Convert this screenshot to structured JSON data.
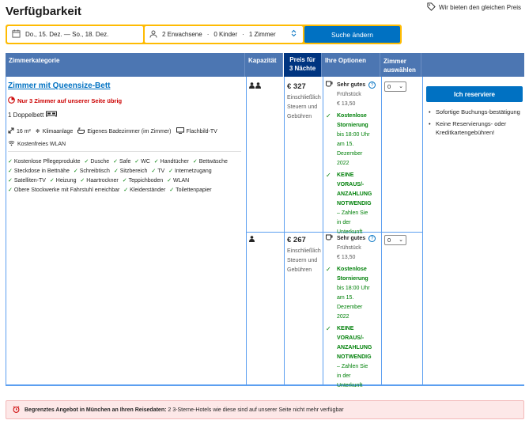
{
  "page": {
    "title": "Verfügbarkeit",
    "price_match": "Wir bieten den gleichen Preis"
  },
  "search": {
    "dates": "Do., 15. Dez. — So., 18. Dez.",
    "adults": "2 Erwachsene",
    "children": "0 Kinder",
    "rooms": "1 Zimmer",
    "submit_label": "Suche ändern"
  },
  "table": {
    "headers": {
      "room_type": "Zimmerkategorie",
      "capacity": "Kapazität",
      "price_line1": "Preis für",
      "price_line2": "3 Nächte",
      "options": "Ihre Optionen",
      "select_line1": "Zimmer",
      "select_line2": "auswählen"
    },
    "room": {
      "name": "Zimmer mit Queensize-Bett",
      "scarcity": "Nur 3 Zimmer auf unserer Seite übrig",
      "bed": "1 Doppelbett",
      "facilities": [
        "16 m²",
        "Klimaanlage",
        "Eigenes Badezimmer (im Zimmer)",
        "Flachbild-TV",
        "Kostenfreies WLAN"
      ],
      "amenities": [
        "Kostenlose Pflegeprodukte",
        "Dusche",
        "Safe",
        "WC",
        "Handtücher",
        "Bettwäsche",
        "Steckdose in Bettnähe",
        "Schreibtisch",
        "Sitzbereich",
        "TV",
        "Internetzugang",
        "Satelliten-TV",
        "Heizung",
        "Haartrockner",
        "Teppichboden",
        "WLAN",
        "Obere Stockwerke mit Fahrstuhl erreichbar",
        "Kleiderständer",
        "Toilettenpapier"
      ]
    },
    "offers": [
      {
        "price": "€ 327",
        "price_note": [
          "Einschließlich",
          "Steuern und",
          "Gebühren"
        ],
        "breakfast_title": "Sehr gutes",
        "breakfast_sub": "Frühstück",
        "breakfast_price": "€ 13,50",
        "cancel_bold": [
          "Kostenlose",
          "Stornierung"
        ],
        "cancel_lines": [
          "bis 18:00 Uhr",
          "am 15.",
          "Dezember",
          "2022"
        ],
        "prepay_bold": [
          "KEINE",
          "VORAUS/-",
          "ANZAHLUNG",
          "NOTWENDIG"
        ],
        "prepay_lines": [
          "– Zahlen Sie",
          "in der",
          "Unterkunft"
        ],
        "quantity": "0"
      },
      {
        "price": "€ 267",
        "price_note": [
          "Einschließlich",
          "Steuern und",
          "Gebühren"
        ],
        "breakfast_title": "Sehr gutes",
        "breakfast_sub": "Frühstück",
        "breakfast_price": "€ 13,50",
        "cancel_bold": [
          "Kostenlose",
          "Stornierung"
        ],
        "cancel_lines": [
          "bis 18:00 Uhr",
          "am 15.",
          "Dezember",
          "2022"
        ],
        "prepay_bold": [
          "KEINE",
          "VORAUS/-",
          "ANZAHLUNG",
          "NOTWENDIG"
        ],
        "prepay_lines": [
          "– Zahlen Sie",
          "in der",
          "Unterkunft"
        ],
        "quantity": "0"
      }
    ],
    "reserve_label": "Ich reserviere",
    "benefits": [
      "Sofortige Buchungs-bestätigung",
      "Keine Reservierungs- oder Kreditkartengebühren!"
    ]
  },
  "alert": {
    "bold": "Begrenztes Angebot in München an Ihren Reisedaten:",
    "text": "2 3-Sterne-Hotels wie diese sind auf unserer Seite nicht mehr verfügbar"
  },
  "colors": {
    "brand_blue": "#0071c2",
    "header_blue": "#4c76b2",
    "dark_blue": "#003580",
    "accent_yellow": "#febb02",
    "green": "#008009",
    "red": "#cc0000"
  }
}
